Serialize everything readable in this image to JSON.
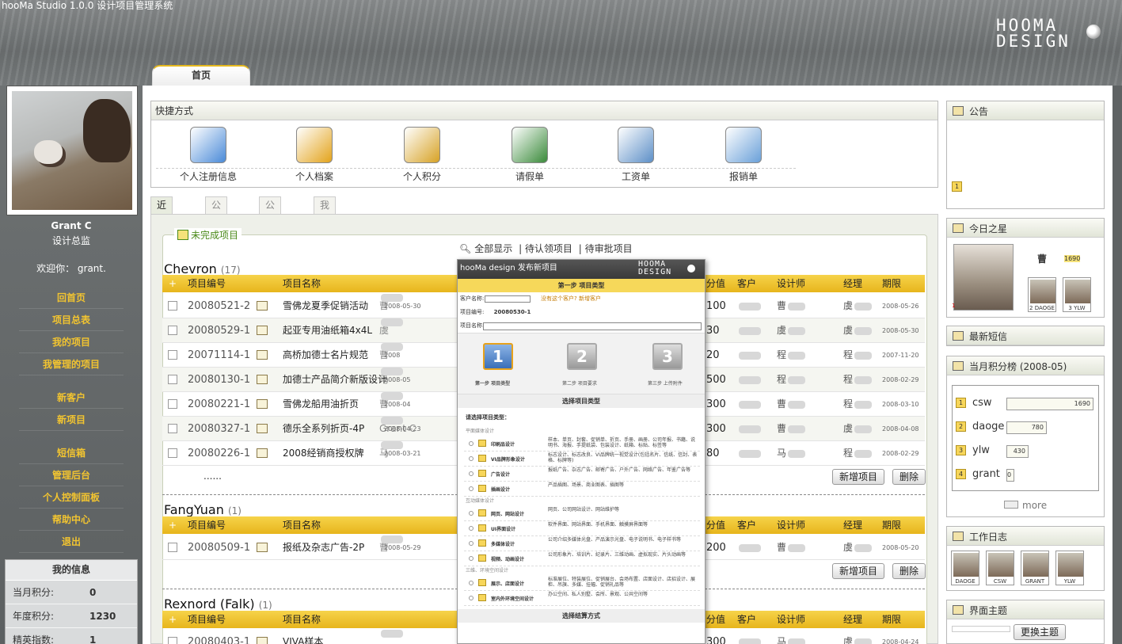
{
  "app": {
    "title": "hooMa Studio 1.0.0 设计项目管理系统",
    "logo": "HOOMA\nDESIGN"
  },
  "main_tab": "首页",
  "user": {
    "name": "Grant C",
    "role": "设计总监",
    "welcome_prefix": "欢迎你：",
    "welcome_name": "grant."
  },
  "nav": [
    "回首页",
    "项目总表",
    "我的项目",
    "我管理的项目",
    "新客户",
    "新项目",
    "短信箱",
    "管理后台",
    "个人控制面板",
    "帮助中心",
    "退出"
  ],
  "my_info": {
    "title": "我的信息",
    "rows": [
      {
        "label": "当月积分:",
        "value": "0"
      },
      {
        "label": "年度积分:",
        "value": "1230"
      },
      {
        "label": "精英指数:",
        "value": "1"
      }
    ]
  },
  "quick": {
    "title": "快捷方式",
    "items": [
      "个人注册信息",
      "个人档案",
      "个人积分",
      "请假单",
      "工资单",
      "报销单"
    ]
  },
  "tabs": [
    "近期项目",
    "公司制度",
    "公司标准",
    "我的日志"
  ],
  "legend": "未完成项目",
  "filters": [
    "全部显示",
    "待认领项目",
    "待审批项目"
  ],
  "columns": {
    "add": "+",
    "id": "项目编号",
    "name": "项目名称",
    "value": "分值",
    "client": "客户",
    "designer": "设计师",
    "manager": "经理",
    "deadline": "期限"
  },
  "groups": [
    {
      "name": "Chevron",
      "count": "(17)",
      "rows": [
        {
          "id": "20080521-2",
          "name": "雪佛龙夏季促销活动",
          "who": "曹",
          "date": "2008-05-30",
          "value": "100",
          "designer": "曹",
          "manager": "虞",
          "deadline": "2008-05-26"
        },
        {
          "id": "20080529-1",
          "name": "起亚专用油纸箱4x4L",
          "who": "虞",
          "date": "",
          "value": "30",
          "designer": "虞",
          "manager": "虞",
          "deadline": "2008-05-30"
        },
        {
          "id": "20071114-1",
          "name": "高桥加德士名片规范",
          "who": "曹",
          "date": "2008",
          "value": "20",
          "designer": "程",
          "manager": "程",
          "deadline": "2007-11-20"
        },
        {
          "id": "20080130-1",
          "name": "加德士产品简介新版设计",
          "who": "马",
          "date": "2008-05",
          "value": "500",
          "designer": "程",
          "manager": "程",
          "deadline": "2008-02-29"
        },
        {
          "id": "20080221-1",
          "name": "雪佛龙船用油折页",
          "who": "曹",
          "date": "2008-04",
          "value": "300",
          "designer": "曹",
          "manager": "程",
          "deadline": "2008-03-10"
        },
        {
          "id": "20080327-1",
          "name": "德乐全系列折页-4P",
          "who": "Grant C",
          "date": "2008-04-23",
          "value": "300",
          "designer": "曹",
          "manager": "虞",
          "deadline": "2008-04-08"
        },
        {
          "id": "20080226-1",
          "name": "2008经销商授权牌",
          "who": "马",
          "date": "2008-03-21",
          "value": "80",
          "designer": "马",
          "manager": "程",
          "deadline": "2008-02-29"
        }
      ]
    },
    {
      "name": "FangYuan",
      "count": "(1)",
      "rows": [
        {
          "id": "20080509-1",
          "name": "报纸及杂志广告-2P",
          "who": "曹",
          "date": "2008-05-29",
          "value": "200",
          "designer": "曹",
          "manager": "虞",
          "deadline": "2008-05-20"
        }
      ]
    },
    {
      "name": "Rexnord (Falk)",
      "count": "(1)",
      "rows": [
        {
          "id": "20080403-1",
          "name": "VIVA样本",
          "who": "",
          "date": "",
          "value": "300",
          "designer": "马",
          "manager": "虞",
          "deadline": "2008-04-24"
        }
      ]
    }
  ],
  "more_rows": "......",
  "buttons": {
    "add_project": "新增项目",
    "delete": "删除"
  },
  "right": {
    "notice": {
      "title": "公告",
      "badge": "1"
    },
    "star": {
      "title": "今日之星",
      "name": "曹",
      "score": "1690",
      "thumbs": [
        "1",
        "2 DAOGE",
        "3 YLW"
      ]
    },
    "sms": {
      "title": "最新短信"
    },
    "ranking": {
      "title": "当月积分榜 (2008-05)",
      "items": [
        {
          "rank": "1",
          "name": "csw",
          "score": "1690",
          "fill": 1.0
        },
        {
          "rank": "2",
          "name": "daoge",
          "score": "780",
          "fill": 0.46
        },
        {
          "rank": "3",
          "name": "ylw",
          "score": "430",
          "fill": 0.25
        },
        {
          "rank": "4",
          "name": "grant",
          "score": "0",
          "fill": 0.0
        }
      ],
      "more": "more"
    },
    "worklog": {
      "title": "工作日志",
      "users": [
        "DAOGE",
        "CSW",
        "GRANT",
        "YLW"
      ]
    },
    "theme": {
      "title": "界面主题",
      "button": "更换主题"
    }
  },
  "modal": {
    "title": "hooMa design 发布新项目",
    "logo": "HOOMA\nDESIGN",
    "step1_title": "第一步  项目类型",
    "client_label": "客户名称:",
    "client_hint": "没有这个客户?  新增客户",
    "id_label": "项目编号:",
    "id_value": "20080530-1",
    "name_label": "项目名称:",
    "steps": [
      {
        "num": "1",
        "label": "第一步  项目类型"
      },
      {
        "num": "2",
        "label": "第二步  项目要求"
      },
      {
        "num": "3",
        "label": "第三步  上传附件"
      }
    ],
    "select_type": "选择项目类型",
    "prompt": "请选择项目类型：",
    "categories": [
      {
        "name": "平面媒体设计",
        "items": [
          {
            "name": "印刷品设计",
            "desc": "样本、单页、封套、促销单、折页、手册、画册、公司年报、书籍、说明书、海报、手提纸袋、包装设计、纸箱、标贴、标签等"
          },
          {
            "name": "VI品牌形象设计",
            "desc": "标志设计、标志改良、VI品牌统一视觉设计(包括名片、信纸、信封、表格、标牌等)"
          },
          {
            "name": "广告设计",
            "desc": "报纸广告、杂志广告、邮寄广告、户外广告、网络广告、年鉴广告等"
          },
          {
            "name": "插画设计",
            "desc": "产品插图、场景、商业图表、插图等"
          }
        ]
      },
      {
        "name": "互动媒体设计",
        "items": [
          {
            "name": "网页、网站设计",
            "desc": "网页、公司网站设计、网站维护等"
          },
          {
            "name": "UI界面设计",
            "desc": "软件界面、网站界面、手机界面、触摸屏界面等"
          },
          {
            "name": "多媒体设计",
            "desc": "公司介绍多媒体光盘、产品演示光盘、电子说明书、电子样书等"
          },
          {
            "name": "视频、动画设计",
            "desc": "公司形象片、培训片、纪录片、三维动画、虚拟现实、片头动画等"
          }
        ]
      },
      {
        "name": "三维、环境空间设计",
        "items": [
          {
            "name": "展示、店面设计",
            "desc": "标准展位、特装展位、促销展台、会场布置、店面设计、店招设计、展柜、吊旗、多媒、挂幅、促销礼品等"
          },
          {
            "name": "室内外环境空间设计",
            "desc": "办公空间、私人别墅、会所、景观、公共空间等"
          }
        ]
      }
    ],
    "pay_title": "选择结算方式"
  }
}
